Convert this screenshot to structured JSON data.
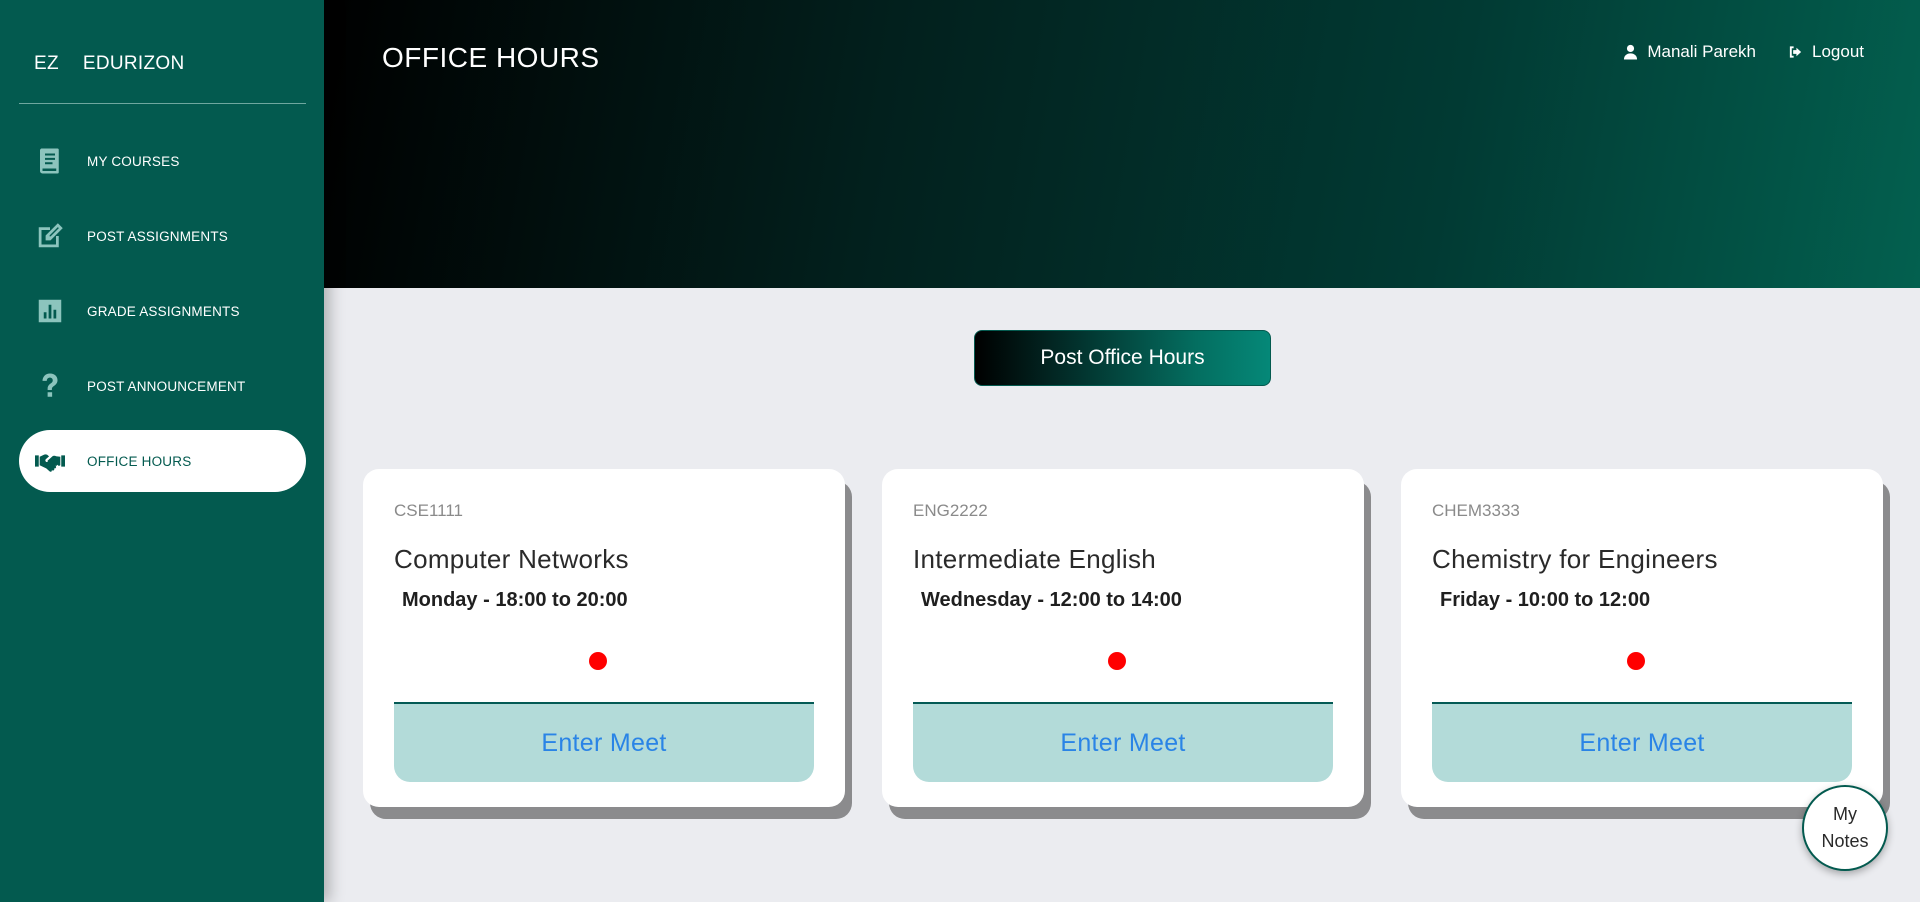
{
  "brand": {
    "short": "EZ",
    "name": "EDURIZON"
  },
  "sidebar": {
    "items": [
      {
        "label": "MY COURSES",
        "icon": "book-icon"
      },
      {
        "label": "POST ASSIGNMENTS",
        "icon": "edit-icon"
      },
      {
        "label": "GRADE ASSIGNMENTS",
        "icon": "chart-icon"
      },
      {
        "label": "POST ANNOUNCEMENT",
        "icon": "question-icon"
      },
      {
        "label": "OFFICE HOURS",
        "icon": "handshake-icon",
        "active": true
      }
    ]
  },
  "header": {
    "title": "OFFICE HOURS",
    "user_name": "Manali Parekh",
    "logout_label": "Logout"
  },
  "main": {
    "post_button_label": "Post Office Hours",
    "cards": [
      {
        "code": "CSE1111",
        "name": "Computer Networks",
        "schedule": "Monday - 18:00 to 20:00",
        "status_color": "#ff0000",
        "button_label": "Enter Meet"
      },
      {
        "code": "ENG2222",
        "name": "Intermediate English",
        "schedule": "Wednesday - 12:00 to 14:00",
        "status_color": "#ff0000",
        "button_label": "Enter Meet"
      },
      {
        "code": "CHEM3333",
        "name": "Chemistry for Engineers",
        "schedule": "Friday - 10:00 to 12:00",
        "status_color": "#ff0000",
        "button_label": "Enter Meet"
      }
    ]
  },
  "notes_fab": {
    "line1": "My",
    "line2": "Notes"
  },
  "colors": {
    "sidebar_bg": "#035a4f",
    "page_bg": "#ebecf0",
    "meet_button_bg": "#b3dbd9",
    "meet_button_text": "#2a84e6",
    "status_dot": "#ff0000"
  }
}
